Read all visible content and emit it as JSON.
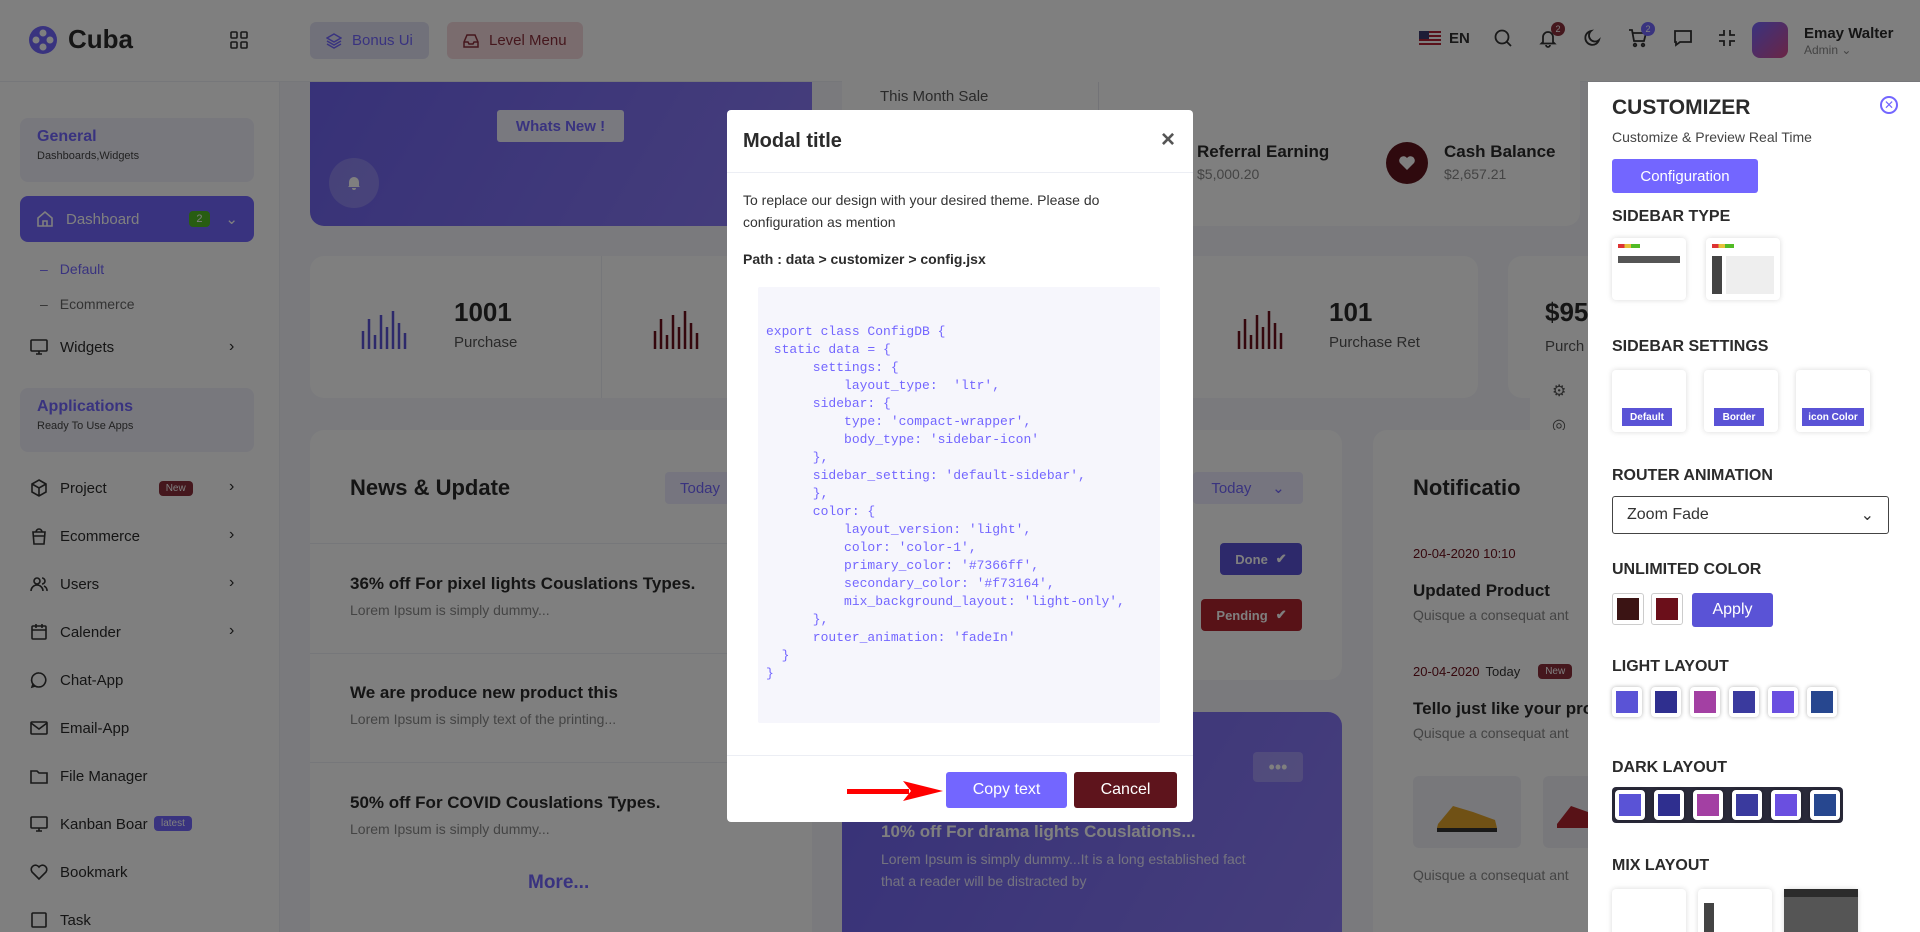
{
  "header": {
    "brand": "Cuba",
    "bonus_label": "Bonus Ui",
    "level_label": "Level Menu",
    "lang": "EN",
    "notif_count": "2",
    "cart_count": "2",
    "user_name": "Emay Walter",
    "user_role": "Admin"
  },
  "sidebar": {
    "general_title": "General",
    "general_sub": "Dashboards,Widgets",
    "dashboard_label": "Dashboard",
    "dashboard_badge": "2",
    "sub_default": "Default",
    "sub_ecommerce": "Ecommerce",
    "widgets": "Widgets",
    "apps_title": "Applications",
    "apps_sub": "Ready To Use Apps",
    "project": "Project",
    "project_badge": "New",
    "ecommerce": "Ecommerce",
    "users": "Users",
    "calender": "Calender",
    "chat": "Chat-App",
    "email": "Email-App",
    "file": "File Manager",
    "kanban": "Kanban Boar",
    "kanban_badge": "latest",
    "bookmark": "Bookmark",
    "task": "Task"
  },
  "main": {
    "whats_new": "Whats New !",
    "this_month": "This Month Sale",
    "referral_title": "Referral Earning",
    "referral_value": "$5,000.20",
    "cash_title": "Cash Balance",
    "cash_value": "$2,657.21",
    "purchase_num": "1001",
    "purchase_lbl": "Purchase",
    "purchase_ret_num": "101",
    "purchase_ret_lbl": "Purchase Ret",
    "fourth_num": "$95",
    "fourth_lbl": "Purch",
    "news_title": "News & Update",
    "today": "Today",
    "news": [
      {
        "title": "36% off For pixel lights Couslations Types.",
        "sub": "Lorem Ipsum is simply dummy..."
      },
      {
        "title": "We are produce new product this",
        "sub": "Lorem Ipsum is simply text of the printing..."
      },
      {
        "title": "50% off For COVID Couslations Types.",
        "sub": "Lorem Ipsum is simply dummy..."
      }
    ],
    "more": "More...",
    "done": "Done",
    "pending": "Pending",
    "notif_title": "Notificatio",
    "n1_date": "20-04-2020 10:10",
    "n1_title": "Updated Product",
    "n1_sub": "Quisque a consequat ant",
    "n2_date": "20-04-2020",
    "n2_today": "Today",
    "n2_badge": "New",
    "n2_title": "Tello just like your pro",
    "n2_sub": "Quisque a consequat ant",
    "n3_sub": "Quisque a consequat ant",
    "drama_title": "10% off For drama lights Couslations...",
    "drama_sub1": "Lorem Ipsum is simply dummy...It is a long established fact",
    "drama_sub2": "that a reader will be distracted by"
  },
  "modal": {
    "title": "Modal title",
    "close": "×",
    "text": "To replace our design with your desired theme. Please do configuration as mention",
    "path": "Path : data > customizer > config.jsx",
    "code": "export class ConfigDB {\n static data = {\n      settings: {\n          layout_type:  'ltr',\n      sidebar: {\n          type: 'compact-wrapper',\n          body_type: 'sidebar-icon'\n      },\n      sidebar_setting: 'default-sidebar',\n      },\n      color: {\n          layout_version: 'light',\n          color: 'color-1',\n          primary_color: '#7366ff',\n          secondary_color: '#f73164',\n          mix_background_layout: 'light-only',\n      },\n      router_animation: 'fadeIn'\n  }\n}",
    "copy_label": "Copy text",
    "cancel_label": "Cancel"
  },
  "customizer": {
    "title": "CUSTOMIZER",
    "subtitle": "Customize & Preview Real Time",
    "config_btn": "Configuration",
    "sidebar_type": "SIDEBAR TYPE",
    "sidebar_settings": "SIDEBAR SETTINGS",
    "ss_default": "Default",
    "ss_border": "Border",
    "ss_icon": "icon Color",
    "router_animation": "ROUTER ANIMATION",
    "router_value": "Zoom Fade",
    "unlimited_color": "UNLIMITED COLOR",
    "apply": "Apply",
    "light_layout": "LIGHT LAYOUT",
    "dark_layout": "DARK LAYOUT",
    "mix_layout": "MIX LAYOUT",
    "light_colors": [
      "#5a53d6",
      "#2f2f8f",
      "#a340a3",
      "#3a3a9e",
      "#6a4fe0",
      "#27478f"
    ],
    "dark_colors": [
      "#5a53d6",
      "#2f2f8f",
      "#a340a3",
      "#3a3a9e",
      "#6a4fe0",
      "#27478f"
    ],
    "unlimited_colors": [
      "#3b1414",
      "#6b0f1a"
    ]
  },
  "colors": {
    "primary": "#7366ff",
    "secondary": "#5e141c",
    "overlay": "rgba(0,0,0,0.5)"
  }
}
